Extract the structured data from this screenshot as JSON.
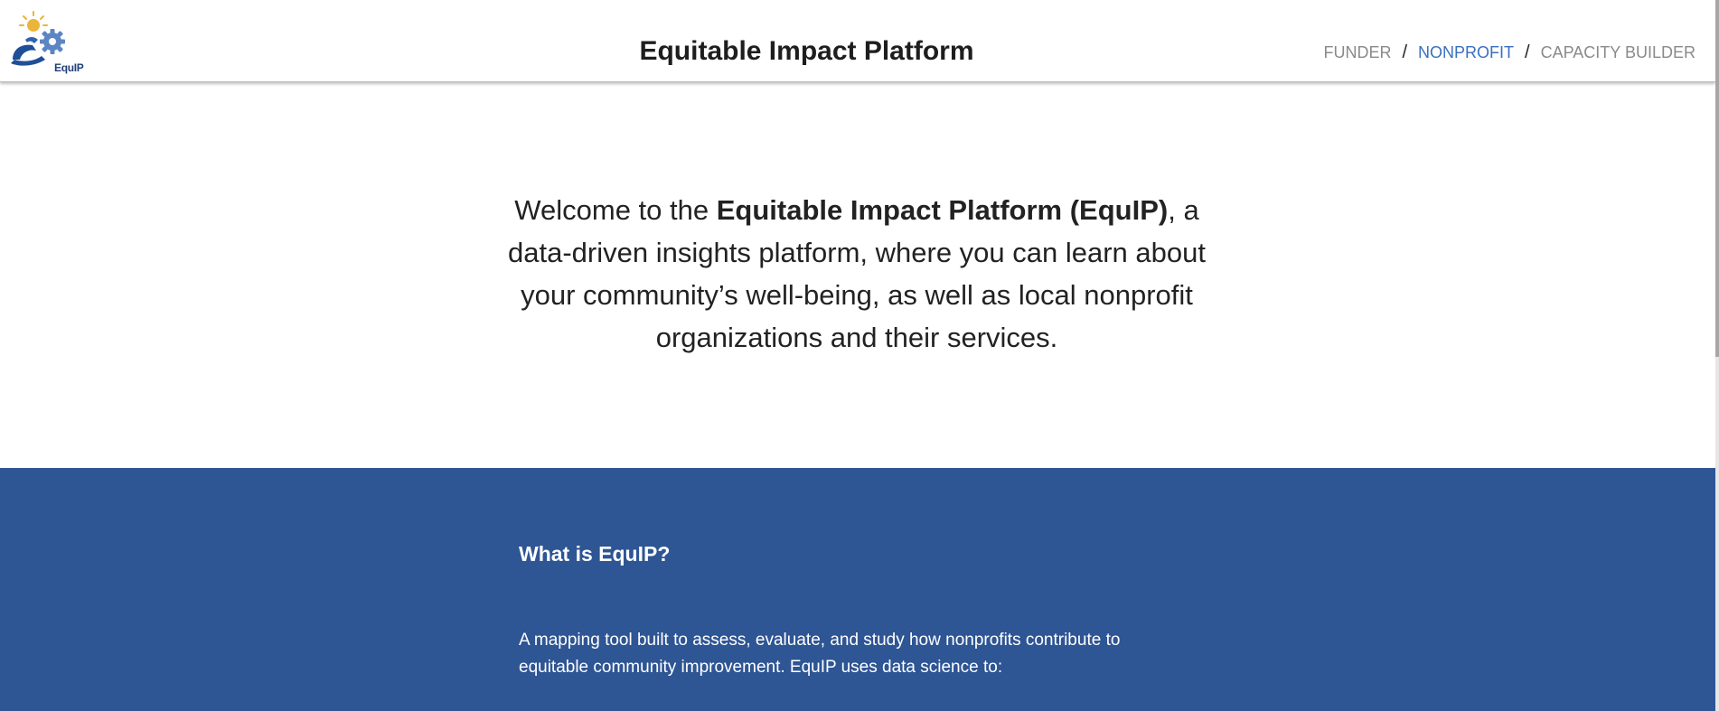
{
  "header": {
    "logo_text": "EquIP",
    "title": "Equitable Impact Platform",
    "nav": {
      "funder": "FUNDER",
      "separator": "/",
      "nonprofit": "NONPROFIT",
      "capacity_builder": "CAPACITY BUILDER"
    },
    "active_nav": "NONPROFIT"
  },
  "hero": {
    "intro": "Welcome to the ",
    "platform_name": "Equitable Impact Platform (EquIP)",
    "rest": ", a data-driven insights platform, where you can learn about your community’s well-being, as well as local nonprofit organizations and their services."
  },
  "about": {
    "heading": "What is EquIP?",
    "body": "A mapping tool built to assess, evaluate, and study how nonprofits contribute to equitable community improvement. EquIP uses data science to:"
  },
  "colors": {
    "accent_blue": "#2e5594",
    "nav_active": "#3a6fc0",
    "nav_inactive": "#8a8a8a",
    "logo_sun": "#e9b53c",
    "logo_gear": "#5b85c4"
  },
  "icons": {
    "logo": "equip-sun-gear-hands-logo"
  }
}
